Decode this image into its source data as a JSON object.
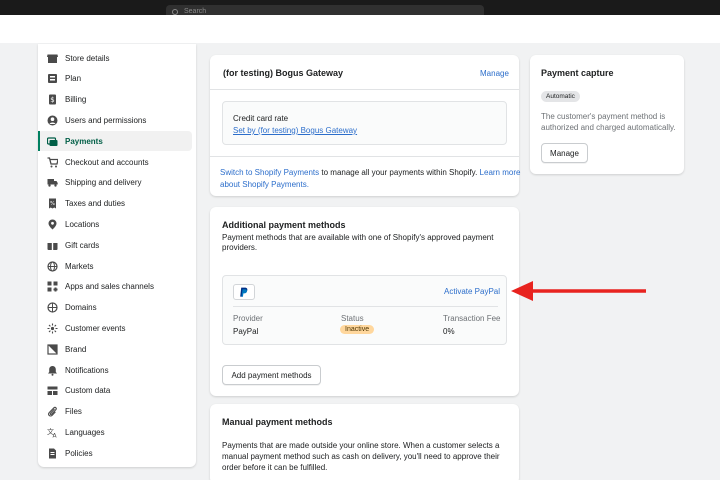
{
  "search": {
    "placeholder": "Search"
  },
  "sidebar": {
    "items": [
      {
        "label": "Store details",
        "icon": "store-icon"
      },
      {
        "label": "Plan",
        "icon": "plan-icon"
      },
      {
        "label": "Billing",
        "icon": "billing-icon"
      },
      {
        "label": "Users and permissions",
        "icon": "user-icon"
      },
      {
        "label": "Payments",
        "icon": "payments-icon",
        "active": true
      },
      {
        "label": "Checkout and accounts",
        "icon": "cart-icon"
      },
      {
        "label": "Shipping and delivery",
        "icon": "truck-icon"
      },
      {
        "label": "Taxes and duties",
        "icon": "tax-icon"
      },
      {
        "label": "Locations",
        "icon": "location-pin-icon"
      },
      {
        "label": "Gift cards",
        "icon": "gift-card-icon"
      },
      {
        "label": "Markets",
        "icon": "globe-icon"
      },
      {
        "label": "Apps and sales channels",
        "icon": "apps-icon"
      },
      {
        "label": "Domains",
        "icon": "domain-globe-icon"
      },
      {
        "label": "Customer events",
        "icon": "customer-events-icon"
      },
      {
        "label": "Brand",
        "icon": "brand-icon"
      },
      {
        "label": "Notifications",
        "icon": "bell-icon"
      },
      {
        "label": "Custom data",
        "icon": "custom-data-icon"
      },
      {
        "label": "Files",
        "icon": "paperclip-icon"
      },
      {
        "label": "Languages",
        "icon": "languages-icon"
      },
      {
        "label": "Policies",
        "icon": "policies-icon"
      }
    ]
  },
  "gateway": {
    "title": "(for testing) Bogus Gateway",
    "manage_label": "Manage",
    "rate_label": "Credit card rate",
    "rate_link": "Set by (for testing) Bogus Gateway",
    "switch_link": "Switch to Shopify Payments",
    "switch_text": " to manage all your payments within Shopify. ",
    "learn_more_1": "Learn more",
    "learn_more_2": "about Shopify Payments."
  },
  "additional": {
    "title": "Additional payment methods",
    "desc_1": "Payment methods that are available with one of Shopify's approved payment",
    "desc_2": "providers.",
    "activate_label": "Activate PayPal",
    "col_provider": "Provider",
    "col_status": "Status",
    "col_fee": "Transaction Fee",
    "provider": "PayPal",
    "status": "Inactive",
    "fee": "0%",
    "add_button": "Add payment methods",
    "accent_red": "#e8231f",
    "status_color": "#ffd79d"
  },
  "manual": {
    "title": "Manual payment methods",
    "desc_1": "Payments that are made outside your online store. When a customer selects a",
    "desc_2": "manual payment method such as cash on delivery, you'll need to approve their",
    "desc_3": "order before it can be fulfilled."
  },
  "capture": {
    "title": "Payment capture",
    "badge": "Automatic",
    "desc_1": "The customer's payment method is",
    "desc_2": "authorized and charged automatically.",
    "manage_label": "Manage"
  }
}
